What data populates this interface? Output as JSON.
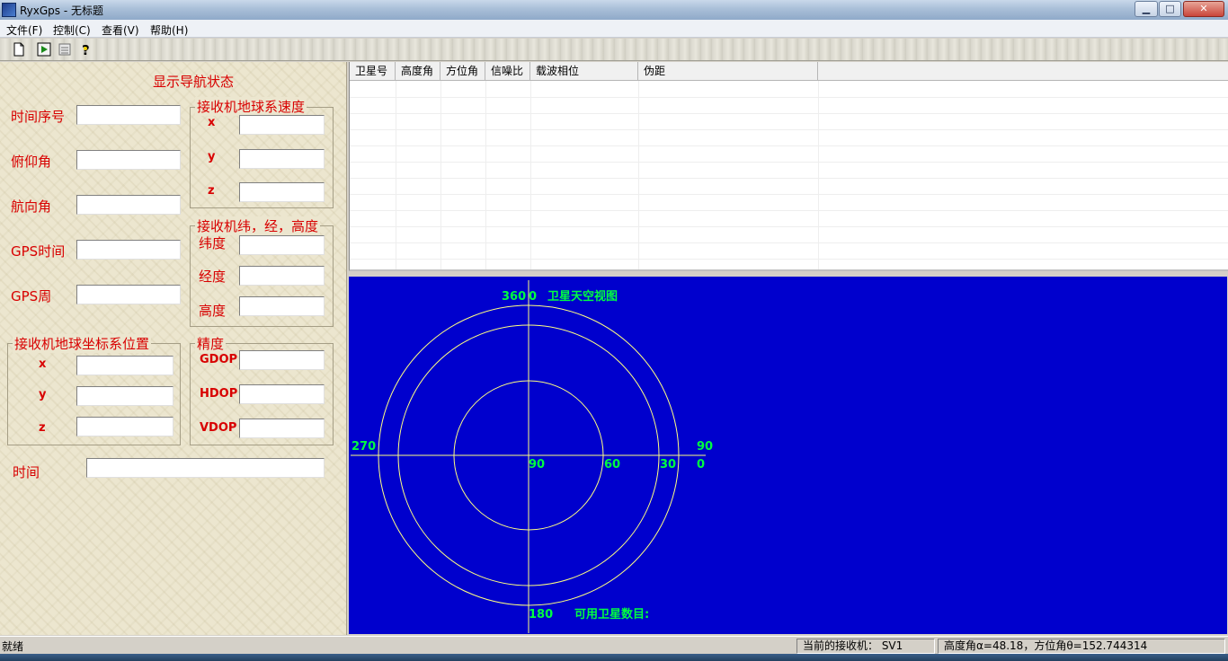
{
  "window": {
    "title": "RyxGps - 无标题",
    "min_label": "▁",
    "max_label": "□",
    "close_label": "✕"
  },
  "menu": [
    "文件(F)",
    "控制(C)",
    "查看(V)",
    "帮助(H)"
  ],
  "toolbar": [
    "new-icon",
    "run-icon",
    "list-icon",
    "help-icon"
  ],
  "left": {
    "heading": "显示导航状态",
    "time_seq": "时间序号",
    "pitch": "俯仰角",
    "heading_angle": "航向角",
    "gps_time": "GPS时间",
    "gps_week": "GPS周",
    "velocity_group": "接收机地球系速度",
    "vx": "x",
    "vy": "y",
    "vz": "z",
    "lla_group": "接收机纬，经，高度",
    "lat": "纬度",
    "lon": "经度",
    "alt": "高度",
    "position_group": "接收机地球坐标系位置",
    "px": "x",
    "py": "y",
    "pz": "z",
    "precision_group": "精度",
    "gdop": "GDOP",
    "hdop": "HDOP",
    "vdop": "VDOP",
    "time": "时间"
  },
  "table": {
    "columns": [
      "卫星号",
      "高度角",
      "方位角",
      "信噪比",
      "载波相位",
      "伪距"
    ]
  },
  "sky": {
    "title": "卫星天空视图",
    "n_360": "360",
    "n_0_top": "0",
    "n_270": "270",
    "n_90_right": "90",
    "n_0_right": "0",
    "n_90_center": "90",
    "n_60": "60",
    "n_30": "30",
    "n_180": "180",
    "available": "可用卫星数目:"
  },
  "status": {
    "ready": "就绪",
    "receiver": "当前的接收机：  SV1",
    "angles": "高度角α=48.18，方位角θ=152.744314"
  },
  "colors": {
    "label_red": "#d80000",
    "sky_blue": "#0000cd",
    "sky_green": "#00ff40",
    "ring_yellow": "#ffff80"
  }
}
